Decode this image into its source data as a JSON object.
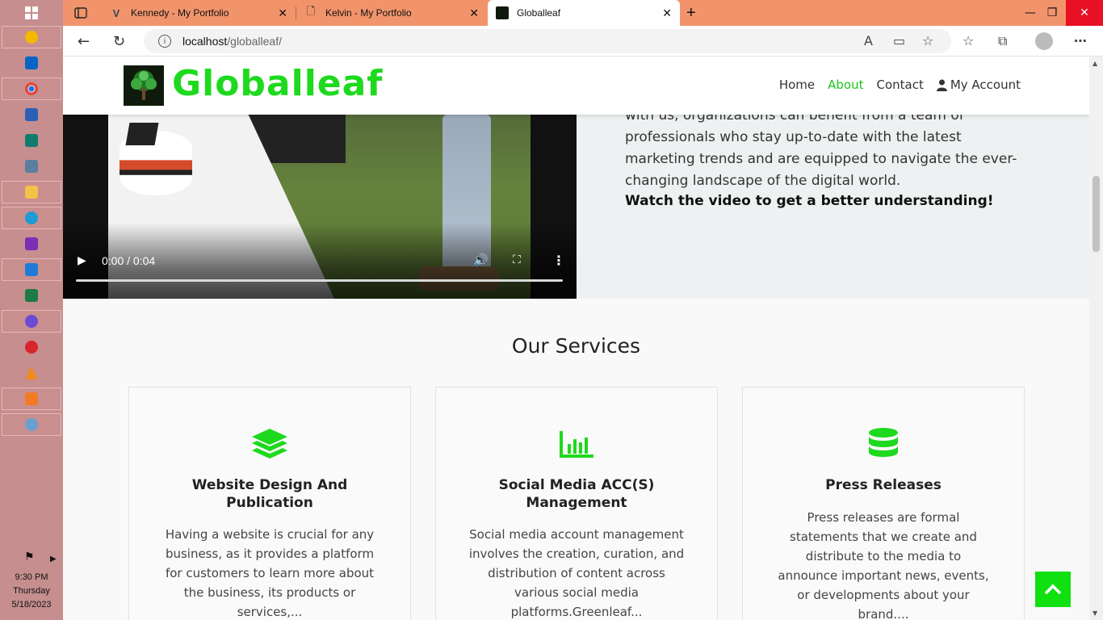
{
  "taskbar": {
    "apps": [
      {
        "name": "start-icon",
        "color": "#ffffff"
      },
      {
        "name": "app-icon-1",
        "color": "#f5b800"
      },
      {
        "name": "outlook-icon",
        "color": "#0a64c4"
      },
      {
        "name": "chrome-icon",
        "color": "#e14a3b"
      },
      {
        "name": "word-icon",
        "color": "#2b5fb4"
      },
      {
        "name": "publisher-icon",
        "color": "#0f7b6c"
      },
      {
        "name": "app-icon-2",
        "color": "#5a7fa0"
      },
      {
        "name": "file-explorer-icon",
        "color": "#f3c247"
      },
      {
        "name": "edge-icon",
        "color": "#1f9ad6"
      },
      {
        "name": "onenote-icon",
        "color": "#7b2fb5"
      },
      {
        "name": "vscode-icon",
        "color": "#1f7bd6"
      },
      {
        "name": "excel-icon",
        "color": "#1d7a45"
      },
      {
        "name": "settings-icon",
        "color": "#6b4ad6"
      },
      {
        "name": "opera-icon",
        "color": "#d8242c"
      },
      {
        "name": "vlc-icon",
        "color": "#f08a1c"
      },
      {
        "name": "xampp-icon",
        "color": "#f27a22"
      },
      {
        "name": "app-icon-3",
        "color": "#6aa0d0"
      }
    ],
    "clock": {
      "time": "9:30 PM",
      "day": "Thursday",
      "date": "5/18/2023"
    }
  },
  "browser": {
    "tabs": [
      {
        "title": "Kennedy - My Portfolio",
        "active": false
      },
      {
        "title": "Kelvin - My Portfolio",
        "active": false
      },
      {
        "title": "Globalleaf",
        "active": true
      }
    ],
    "new_tab": "+",
    "url_host": "localhost",
    "url_path": "/globalleaf/"
  },
  "header": {
    "brand": "Globalleaf",
    "nav": [
      {
        "label": "Home"
      },
      {
        "label": "About",
        "active": true
      },
      {
        "label": "Contact"
      },
      {
        "label": "My Account"
      }
    ]
  },
  "about": {
    "video_time": "0:00 / 0:04",
    "lines": [
      "with us, organizations can benefit from a team of",
      "professionals who stay up-to-date with the latest",
      "marketing trends and are equipped to navigate the ever-",
      "changing landscape of the digital world."
    ],
    "cta": "Watch the video to get a better understanding!"
  },
  "services": {
    "title": "Our Services",
    "cards": [
      {
        "icon": "layers-icon",
        "title_lines": [
          "Website Design And",
          "Publication"
        ],
        "desc_lines": [
          "Having a website is crucial for any",
          "business, as it provides a platform",
          "for customers to learn more about",
          "the business, its products or",
          "services,..."
        ]
      },
      {
        "icon": "bar-chart-icon",
        "title_lines": [
          "Social Media ACC(S)",
          "Management"
        ],
        "desc_lines": [
          "Social media account management",
          "involves the creation, curation, and",
          "distribution of content across",
          "various social media",
          "platforms.Greenleaf..."
        ]
      },
      {
        "icon": "database-icon",
        "title_lines": [
          "Press Releases"
        ],
        "desc_lines": [
          "Press releases are formal",
          "statements that we create and",
          "distribute to the media to",
          "announce important news, events,",
          "or developments about your",
          "brand...."
        ]
      }
    ]
  },
  "colors": {
    "accent": "#1ed91e",
    "tabbar": "#f1946c",
    "taskbar": "#c68e8e"
  }
}
